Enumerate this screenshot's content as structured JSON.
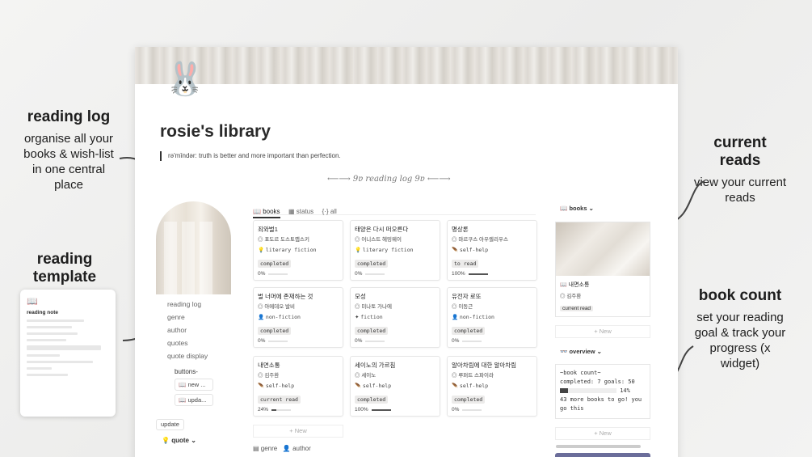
{
  "annotations": {
    "reading_log": {
      "title": "reading log",
      "desc": "organise all your books & wish-list in one central place"
    },
    "reading_template": {
      "title": "reading template"
    },
    "current_reads": {
      "title": "current reads",
      "desc": "view your current reads"
    },
    "book_count": {
      "title": "book count",
      "desc": "set your reading goal & track your progress (x widget)"
    }
  },
  "page": {
    "title": "rosie's library",
    "reminder": "rə'mīndər: truth is better and more important than perfection.",
    "divider": "⟵⟶ 9ɐ reading log 9ɐ ⟵⟶"
  },
  "left": {
    "links": [
      "reading log",
      "genre",
      "author",
      "quotes",
      "quote display"
    ],
    "buttons_label": "buttons-",
    "buttons": [
      "new ...",
      "upda..."
    ],
    "update": "update",
    "quote_toggle": "quote"
  },
  "tabs": [
    "books",
    "status",
    "all"
  ],
  "cards": [
    {
      "name": "죄와벌1",
      "author": "표도르 도스토옙스키",
      "genre": "literary fiction",
      "status": "completed",
      "progress": "0%",
      "pct": 0
    },
    {
      "name": "태양은 다시 떠오른다",
      "author": "어니스트 헤밍웨이",
      "genre": "literary fiction",
      "status": "completed",
      "progress": "0%",
      "pct": 0
    },
    {
      "name": "명상론",
      "author": "마르쿠스 아우렐리우스",
      "genre": "self-help",
      "status": "to read",
      "progress": "100%",
      "pct": 100
    },
    {
      "name": "벌 너머에 존재하는 것",
      "author": "아메데오 발비",
      "genre": "non-fiction",
      "status": "completed",
      "progress": "0%",
      "pct": 0
    },
    {
      "name": "모성",
      "author": "미나토 가나에",
      "genre": "fiction",
      "status": "completed",
      "progress": "0%",
      "pct": 0
    },
    {
      "name": "유전자 로또",
      "author": "이동근",
      "genre": "non-fiction",
      "status": "completed",
      "progress": "0%",
      "pct": 0
    },
    {
      "name": "내면소통",
      "author": "김주환",
      "genre": "self-help",
      "status": "current read",
      "progress": "24%",
      "pct": 24
    },
    {
      "name": "세이노의 가르침",
      "author": "세이노",
      "genre": "self-help",
      "status": "completed",
      "progress": "100%",
      "pct": 100
    },
    {
      "name": "알아차림에 대한 알아차림",
      "author": "루퍼트 스파이라",
      "genre": "self-help",
      "status": "completed",
      "progress": "0%",
      "pct": 0
    }
  ],
  "new_label": "+ New",
  "bottom_tabs": [
    "genre",
    "author"
  ],
  "right": {
    "books_header": "books",
    "current": {
      "name": "내면소통",
      "author": "김주환",
      "status": "current read"
    },
    "overview_header": "overview",
    "widget": {
      "title": "~book count~",
      "line": "completed: 7 goals: 50",
      "pct_label": "14%",
      "pct": 14,
      "message": "43 more books to go! you go this"
    }
  },
  "template": {
    "title": "reading note"
  }
}
